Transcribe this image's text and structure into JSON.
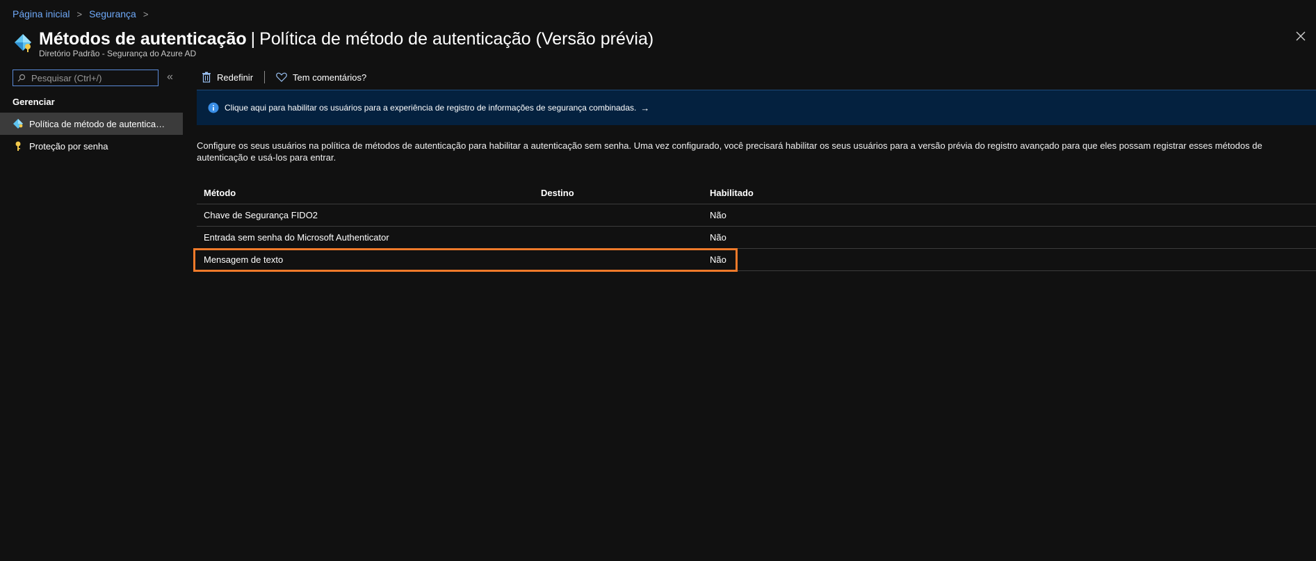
{
  "breadcrumb": [
    {
      "label": "Página inicial"
    },
    {
      "label": "Segurança"
    }
  ],
  "header": {
    "title_strong": "Métodos de autenticação",
    "title_separator": "|",
    "title_rest": "Política de método de autenticação (Versão prévia)",
    "subtitle": "Diretório Padrão - Segurança do Azure AD"
  },
  "sidebar": {
    "search_placeholder": "Pesquisar (Ctrl+/)",
    "collapse_label": "«",
    "section_label": "Gerenciar",
    "items": [
      {
        "label": "Política de método de autenticação (Versão prévia)",
        "icon": "auth-methods-icon",
        "active": true
      },
      {
        "label": "Proteção por senha",
        "icon": "key-icon",
        "active": false
      }
    ]
  },
  "toolbar": {
    "reset_label": "Redefinir",
    "feedback_label": "Tem comentários?"
  },
  "banner": {
    "text": "Clique aqui para habilitar os usuários para a experiência de registro de informações de segurança combinadas.",
    "arrow": "→"
  },
  "description": "Configure os seus usuários na política de métodos de autenticação para habilitar a autenticação sem senha. Uma vez configurado, você precisará habilitar os seus usuários para a versão prévia do registro avançado para que eles possam registrar esses métodos de autenticação e usá-los para entrar.",
  "table": {
    "columns": [
      "Método",
      "Destino",
      "Habilitado"
    ],
    "rows": [
      {
        "method": "Chave de Segurança FIDO2",
        "target": "",
        "enabled": "Não"
      },
      {
        "method": "Entrada sem senha do Microsoft Authenticator",
        "target": "",
        "enabled": "Não"
      },
      {
        "method": "Mensagem de texto",
        "target": "",
        "enabled": "Não"
      }
    ]
  },
  "colors": {
    "background": "#111111",
    "link": "#6ea8f7",
    "banner_bg": "#04213f",
    "highlight": "#ef7a2a",
    "active_nav": "#3b3b3b"
  }
}
